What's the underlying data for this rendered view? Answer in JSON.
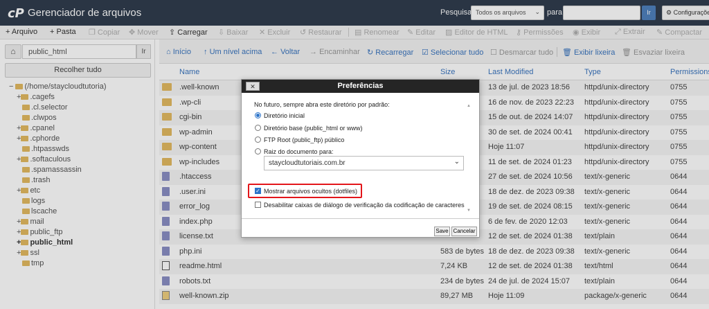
{
  "app": {
    "logo": "cP",
    "title": "Gerenciador de arquivos"
  },
  "search": {
    "label": "Pesquisar",
    "scope": "Todos os arquivos",
    "for_label": "para",
    "go": "Ir",
    "settings": "Configurações"
  },
  "toolbar": [
    "Arquivo",
    "Pasta",
    "Copiar",
    "Mover",
    "Carregar",
    "Baixar",
    "Excluir",
    "Restaurar",
    "Renomear",
    "Editar",
    "Editor de HTML",
    "Permissões",
    "Exibir",
    "Extrair",
    "Compactar"
  ],
  "sidebar": {
    "path": "public_html",
    "go": "Ir",
    "collapse": "Recolher tudo",
    "tree": [
      {
        "prefix": "− ",
        "label": "(/home/staycloudtutoria)"
      },
      {
        "prefix": "+",
        "label": ".cagefs"
      },
      {
        "prefix": "",
        "label": ".cl.selector"
      },
      {
        "prefix": "",
        "label": ".clwpos"
      },
      {
        "prefix": "+",
        "label": ".cpanel"
      },
      {
        "prefix": "+",
        "label": ".cphorde"
      },
      {
        "prefix": "",
        "label": ".htpasswds"
      },
      {
        "prefix": "+",
        "label": ".softaculous"
      },
      {
        "prefix": "",
        "label": ".spamassassin"
      },
      {
        "prefix": "",
        "label": ".trash"
      },
      {
        "prefix": "+",
        "label": "etc"
      },
      {
        "prefix": "",
        "label": "logs"
      },
      {
        "prefix": "",
        "label": "lscache"
      },
      {
        "prefix": "+",
        "label": "mail"
      },
      {
        "prefix": "+",
        "label": "public_ftp"
      },
      {
        "prefix": "+",
        "label": "public_html"
      },
      {
        "prefix": "+",
        "label": "ssl"
      },
      {
        "prefix": "",
        "label": "tmp"
      }
    ]
  },
  "nav": [
    "Início",
    "Um nível acima",
    "Voltar",
    "Encaminhar",
    "Recarregar",
    "Selecionar tudo",
    "Desmarcar tudo",
    "Exibir lixeira",
    "Esvaziar lixeira"
  ],
  "columns": {
    "name": "Name",
    "size": "Size",
    "modified": "Last Modified",
    "type": "Type",
    "perms": "Permissions"
  },
  "files": [
    {
      "icon": "dir",
      "name": ".well-known",
      "size": "",
      "modified": "13 de jul. de 2023 18:56",
      "type": "httpd/unix-directory",
      "perms": "0755"
    },
    {
      "icon": "dir",
      "name": ".wp-cli",
      "size": "",
      "modified": "16 de nov. de 2023 22:23",
      "type": "httpd/unix-directory",
      "perms": "0755"
    },
    {
      "icon": "dir",
      "name": "cgi-bin",
      "size": "",
      "modified": "15 de out. de 2024 14:07",
      "type": "httpd/unix-directory",
      "perms": "0755"
    },
    {
      "icon": "dir",
      "name": "wp-admin",
      "size": "",
      "modified": "30 de set. de 2024 00:41",
      "type": "httpd/unix-directory",
      "perms": "0755"
    },
    {
      "icon": "dir",
      "name": "wp-content",
      "size": "",
      "modified": "Hoje 11:07",
      "type": "httpd/unix-directory",
      "perms": "0755"
    },
    {
      "icon": "dir",
      "name": "wp-includes",
      "size": "",
      "modified": "11 de set. de 2024 01:23",
      "type": "httpd/unix-directory",
      "perms": "0755"
    },
    {
      "icon": "doc",
      "name": ".htaccess",
      "size": "",
      "modified": "27 de set. de 2024 10:56",
      "type": "text/x-generic",
      "perms": "0644"
    },
    {
      "icon": "doc",
      "name": ".user.ini",
      "size": "",
      "modified": "18 de dez. de 2023 09:38",
      "type": "text/x-generic",
      "perms": "0644"
    },
    {
      "icon": "doc",
      "name": "error_log",
      "size": "",
      "modified": "19 de set. de 2024 08:15",
      "type": "text/x-generic",
      "perms": "0644"
    },
    {
      "icon": "doc",
      "name": "index.php",
      "size": "",
      "modified": "6 de fev. de 2020 12:03",
      "type": "text/x-generic",
      "perms": "0644"
    },
    {
      "icon": "doc",
      "name": "license.txt",
      "size": "",
      "modified": "12 de set. de 2024 01:38",
      "type": "text/plain",
      "perms": "0644"
    },
    {
      "icon": "doc",
      "name": "php.ini",
      "size": "583 de bytes",
      "modified": "18 de dez. de 2023 09:38",
      "type": "text/x-generic",
      "perms": "0644"
    },
    {
      "icon": "html",
      "name": "readme.html",
      "size": "7,24 KB",
      "modified": "12 de set. de 2024 01:38",
      "type": "text/html",
      "perms": "0644"
    },
    {
      "icon": "doc",
      "name": "robots.txt",
      "size": "234 de bytes",
      "modified": "24 de jul. de 2024 15:07",
      "type": "text/plain",
      "perms": "0644"
    },
    {
      "icon": "zip",
      "name": "well-known.zip",
      "size": "89,27 MB",
      "modified": "Hoje 11:09",
      "type": "package/x-generic",
      "perms": "0644"
    }
  ],
  "dialog": {
    "title": "Preferências",
    "close": "✕",
    "intro": "No futuro, sempre abra este diretório por padrão:",
    "radios": [
      {
        "label": "Diretório inicial",
        "selected": true
      },
      {
        "label": "Diretório base (public_html or www)",
        "selected": false
      },
      {
        "label": "FTP Root (public_ftp) público",
        "selected": false
      },
      {
        "label": "Raiz do documento para:",
        "selected": false
      }
    ],
    "domain": "staycloudtutoriais.com.br",
    "show_hidden": "Mostrar arquivos ocultos (dotfiles)",
    "show_hidden_checked": true,
    "disable_encoding": "Desabilitar caixas de diálogo de verificação da codificação de caracteres",
    "disable_encoding_checked": false,
    "save": "Save",
    "cancel": "Cancelar"
  }
}
